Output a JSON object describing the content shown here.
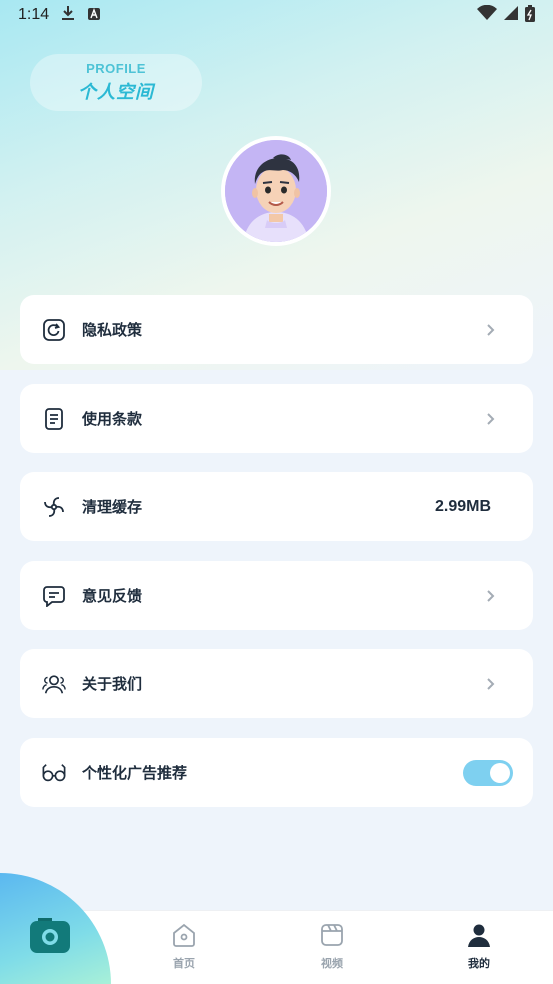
{
  "status_bar": {
    "time": "1:14"
  },
  "header": {
    "chip_en": "PROFILE",
    "chip_cn": "个人空间"
  },
  "menu": [
    {
      "label": "隐私政策",
      "icon": "refresh-square-icon",
      "trailing": "chevron"
    },
    {
      "label": "使用条款",
      "icon": "document-icon",
      "trailing": "chevron"
    },
    {
      "label": "清理缓存",
      "icon": "fan-icon",
      "trailing": "value",
      "value": "2.99MB"
    },
    {
      "label": "意见反馈",
      "icon": "message-icon",
      "trailing": "chevron"
    },
    {
      "label": "关于我们",
      "icon": "users-icon",
      "trailing": "chevron"
    },
    {
      "label": "个性化广告推荐",
      "icon": "glasses-icon",
      "trailing": "toggle",
      "toggle_on": true
    }
  ],
  "bottom_nav": [
    {
      "label": "首页",
      "icon": "home-icon",
      "active": false
    },
    {
      "label": "视频",
      "icon": "video-icon",
      "active": false
    },
    {
      "label": "我的",
      "icon": "user-icon",
      "active": true
    }
  ],
  "colors": {
    "accent": "#7ed0f0",
    "text": "#1f2d3d",
    "inactive": "#9aa4ae"
  }
}
